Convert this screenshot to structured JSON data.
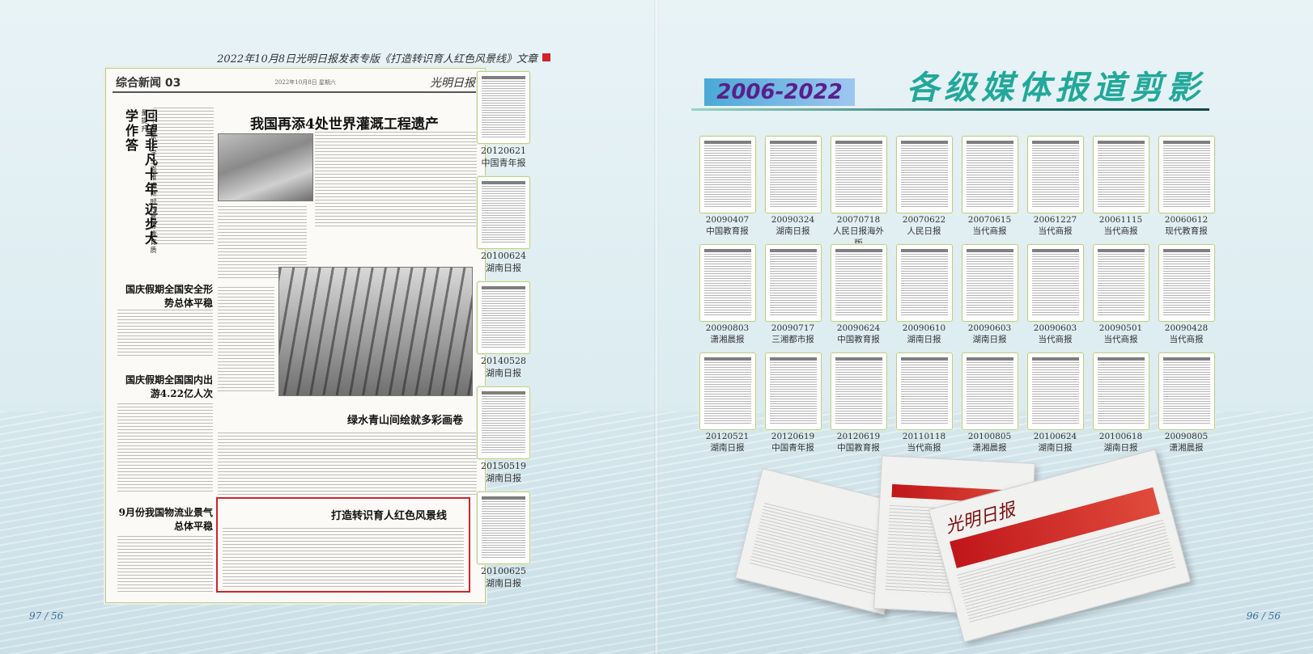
{
  "left": {
    "caption": "2022年10月8日光明日报发表专版《打造转识育人红色风景线》文章",
    "newspaper": {
      "section": "综合新闻 03",
      "logo": "光明日报",
      "meta": "2022年10月8日 星期六",
      "headlines": {
        "main": "我国再添4处世界灌溉工程遗产",
        "vertical": "回望非凡十年 迈步大学作答",
        "vertical_sub": "——山东大学全面推进新时代高等教育质量提升",
        "h2": "国庆假期全国安全形势总体平稳",
        "h3": "国庆假期全国国内出游4.22亿人次",
        "h4": "绿水青山间绘就多彩画卷",
        "h5": "9月份我国物流业景气总体平稳",
        "featured": "打造转识育人红色风景线"
      }
    },
    "thumbs": [
      {
        "date": "20120621",
        "paper": "中国青年报"
      },
      {
        "date": "20100624",
        "paper": "湖南日报"
      },
      {
        "date": "20140528",
        "paper": "湖南日报"
      },
      {
        "date": "20150519",
        "paper": "湖南日报"
      },
      {
        "date": "20100625",
        "paper": "湖南日报"
      }
    ],
    "page_number": "97 / 56"
  },
  "right": {
    "title": "各级媒体报道剪影",
    "years": "2006-2022",
    "grid": [
      [
        {
          "date": "20090407",
          "paper": "中国教育报"
        },
        {
          "date": "20090324",
          "paper": "湖南日报"
        },
        {
          "date": "20070718",
          "paper": "人民日报海外版"
        },
        {
          "date": "20070622",
          "paper": "人民日报"
        },
        {
          "date": "20070615",
          "paper": "当代商报"
        },
        {
          "date": "20061227",
          "paper": "当代商报"
        },
        {
          "date": "20061115",
          "paper": "当代商报"
        },
        {
          "date": "20060612",
          "paper": "现代教育报"
        }
      ],
      [
        {
          "date": "20090803",
          "paper": "潇湘晨报"
        },
        {
          "date": "20090717",
          "paper": "三湘都市报"
        },
        {
          "date": "20090624",
          "paper": "中国教育报"
        },
        {
          "date": "20090610",
          "paper": "湖南日报"
        },
        {
          "date": "20090603",
          "paper": "湖南日报"
        },
        {
          "date": "20090603",
          "paper": "当代商报"
        },
        {
          "date": "20090501",
          "paper": "当代商报"
        },
        {
          "date": "20090428",
          "paper": "当代商报"
        }
      ],
      [
        {
          "date": "20120521",
          "paper": "湖南日报"
        },
        {
          "date": "20120619",
          "paper": "中国青年报"
        },
        {
          "date": "20120619",
          "paper": "中国教育报"
        },
        {
          "date": "20110118",
          "paper": "当代商报"
        },
        {
          "date": "20100805",
          "paper": "潇湘晨报"
        },
        {
          "date": "20100624",
          "paper": "湖南日报"
        },
        {
          "date": "20100618",
          "paper": "湖南日报"
        },
        {
          "date": "20090805",
          "paper": "潇湘晨报"
        }
      ]
    ],
    "stack_mast": "光明日报",
    "page_number": "96 / 56"
  }
}
